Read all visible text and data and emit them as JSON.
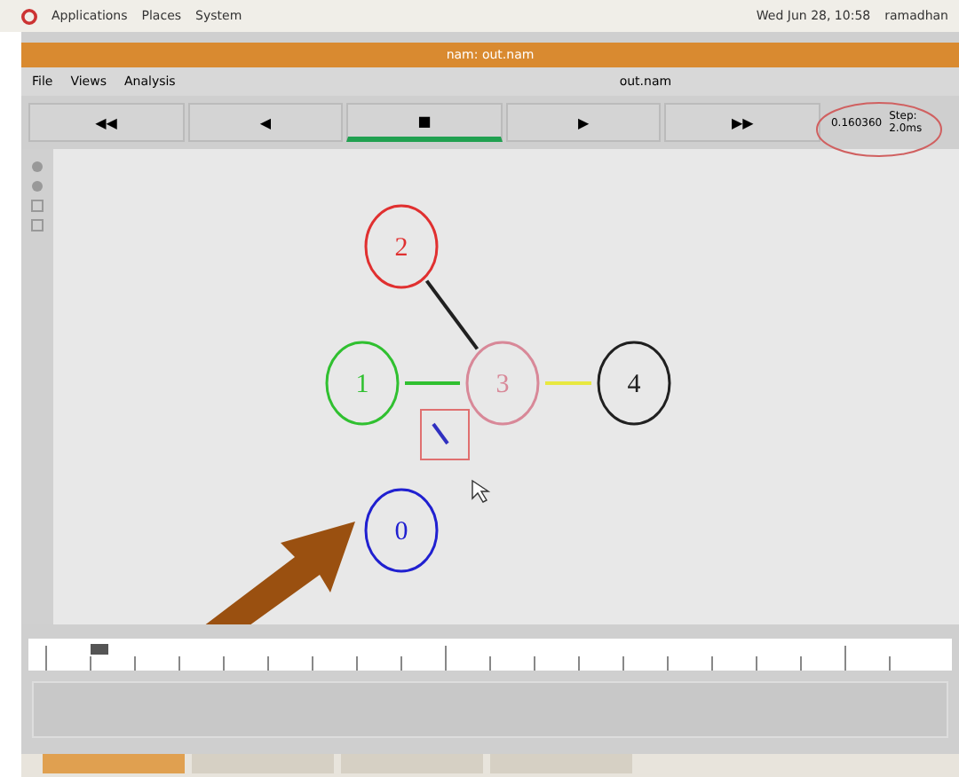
{
  "top_panel": {
    "menus": [
      "Applications",
      "Places",
      "System"
    ],
    "clock": "Wed Jun 28, 10:58",
    "user": "ramadhan"
  },
  "window": {
    "title": "nam: out.nam"
  },
  "menu": [
    "File",
    "Views",
    "Analysis"
  ],
  "file_label": "out.nam",
  "playback": [
    {
      "symbol": "◀◀",
      "selected": false
    },
    {
      "symbol": "◀",
      "selected": false
    },
    {
      "symbol": "■",
      "selected": true
    },
    {
      "symbol": "▶",
      "selected": false
    },
    {
      "symbol": "▶▶",
      "selected": false
    }
  ],
  "time": "0.160360",
  "step": "Step: 2.0ms",
  "nodes": [
    {
      "label": "0",
      "color": "#2020d0"
    },
    {
      "label": "1",
      "color": "#30c030"
    },
    {
      "label": "2",
      "color": "#e03030"
    },
    {
      "label": "3",
      "color": "#d88898"
    },
    {
      "label": "4",
      "color": "#202020"
    }
  ],
  "links": [
    {
      "color": "#202020"
    },
    {
      "color": "#30c030"
    },
    {
      "color": "#e8e840"
    }
  ],
  "timeline": {
    "level": 0.06
  }
}
